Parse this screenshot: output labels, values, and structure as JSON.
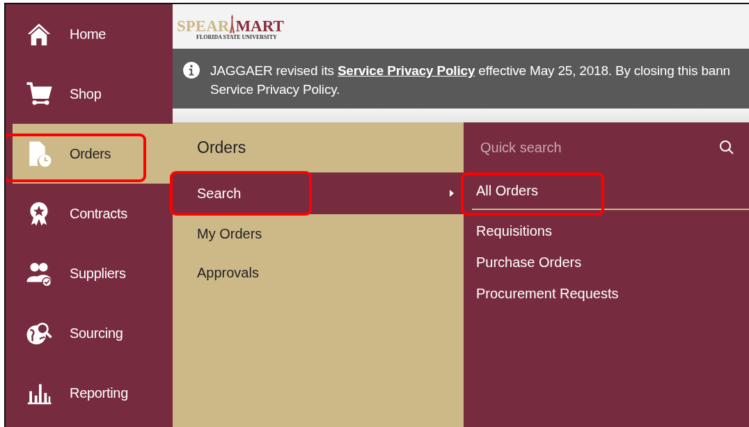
{
  "sidebar": {
    "items": [
      {
        "label": "Home",
        "selected": false,
        "highlighted": false
      },
      {
        "label": "Shop",
        "selected": false,
        "highlighted": false
      },
      {
        "label": "Orders",
        "selected": true,
        "highlighted": true
      },
      {
        "label": "Contracts",
        "selected": false,
        "highlighted": false
      },
      {
        "label": "Suppliers",
        "selected": false,
        "highlighted": false
      },
      {
        "label": "Sourcing",
        "selected": false,
        "highlighted": false
      },
      {
        "label": "Reporting",
        "selected": false,
        "highlighted": false
      }
    ]
  },
  "logo": {
    "left": "SPEAR",
    "right": "MART",
    "subtitle": "FLORIDA STATE UNIVERSITY"
  },
  "banner": {
    "before": "JAGGAER revised its ",
    "link": "Service Privacy Policy",
    "after": " effective May 25, 2018. By closing this bann",
    "second_line": "Service Privacy Policy."
  },
  "submenu": {
    "title": "Orders",
    "items": [
      {
        "label": "Search",
        "selected": true,
        "highlighted": true
      },
      {
        "label": "My Orders",
        "selected": false,
        "highlighted": false
      },
      {
        "label": "Approvals",
        "selected": false,
        "highlighted": false
      }
    ]
  },
  "search_panel": {
    "placeholder": "Quick search",
    "items": [
      {
        "label": "All Orders",
        "highlighted": true
      },
      {
        "label": "Requisitions",
        "highlighted": false
      },
      {
        "label": "Purchase Orders",
        "highlighted": false
      },
      {
        "label": "Procurement Requests",
        "highlighted": false
      }
    ]
  }
}
